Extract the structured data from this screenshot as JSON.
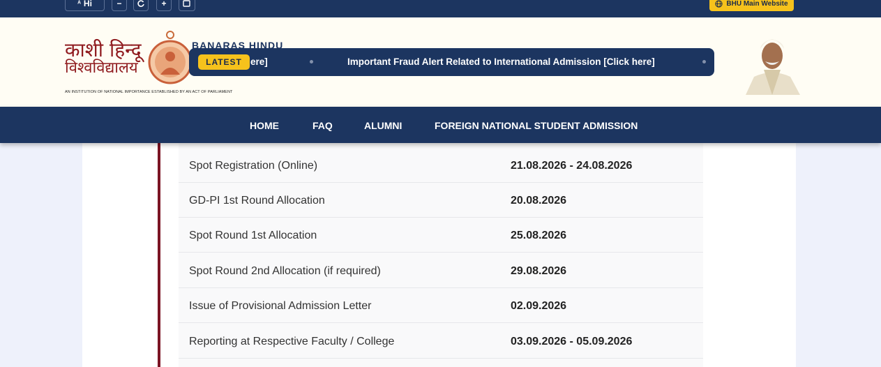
{
  "topbar": {
    "lang_label": "Hi",
    "decrease_label": "−",
    "increase_label": "+",
    "main_website_label": "BHU Main Website"
  },
  "header": {
    "logo_hindi_line1": "काशी हिन्दू",
    "logo_hindi_line2": "विश्वविद्यालय",
    "logo_en_partial": "BANARAS HINDU",
    "tagline": "AN INSTITUTION OF NATIONAL IMPORTANCE ESTABLISHED BY AN ACT OF PARLIAMENT",
    "ticker": {
      "badge": "LATEST",
      "items": [
        "ere]",
        "Important Fraud Alert Related to International Admission [Click here]"
      ]
    }
  },
  "nav": {
    "items": [
      "HOME",
      "FAQ",
      "ALUMNI",
      "FOREIGN NATIONAL STUDENT ADMISSION"
    ]
  },
  "schedule": {
    "rows": [
      {
        "event": "Spot Registration (Online)",
        "date": "21.08.2026 - 24.08.2026"
      },
      {
        "event": "GD-PI 1st Round Allocation",
        "date": "20.08.2026"
      },
      {
        "event": "Spot Round 1st Allocation",
        "date": "25.08.2026"
      },
      {
        "event": "Spot Round 2nd Allocation (if required)",
        "date": "29.08.2026"
      },
      {
        "event": "Issue of Provisional Admission Letter",
        "date": "02.09.2026"
      },
      {
        "event": "Reporting at Respective Faculty / College",
        "date": "03.09.2026 - 05.09.2026"
      }
    ]
  },
  "colors": {
    "navy": "#1c3560",
    "accent_yellow": "#f6c21c",
    "maroon": "#7b1424"
  }
}
